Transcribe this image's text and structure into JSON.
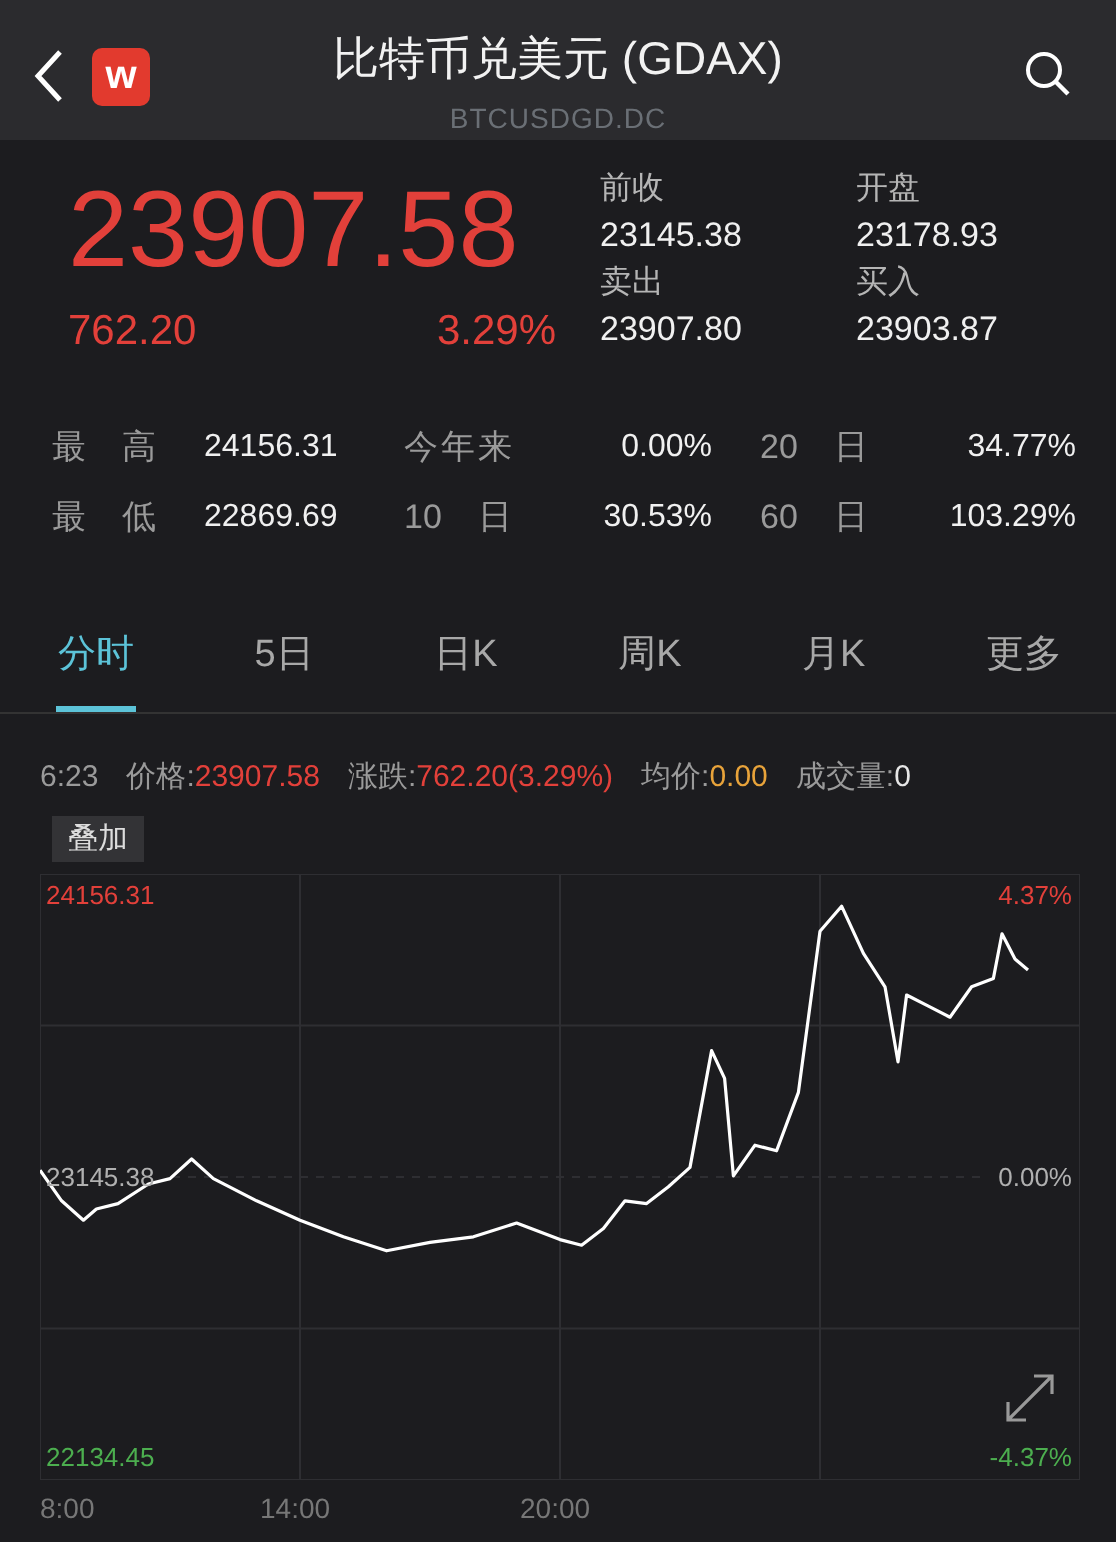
{
  "header": {
    "logo": "w",
    "title": "比特币兑美元 (GDAX)",
    "subtitle": "BTCUSDGD.DC"
  },
  "quote": {
    "price": "23907.58",
    "change": "762.20",
    "change_pct": "3.29%",
    "fields": [
      {
        "label": "前收",
        "value": "23145.38"
      },
      {
        "label": "开盘",
        "value": "23178.93"
      },
      {
        "label": "卖出",
        "value": "23907.80"
      },
      {
        "label": "买入",
        "value": "23903.87"
      }
    ]
  },
  "stats": [
    [
      {
        "label": "最 高",
        "value": "24156.31"
      },
      {
        "label": "今年来",
        "value": "0.00%"
      },
      {
        "label": "20 日",
        "value": "34.77%"
      }
    ],
    [
      {
        "label": "最 低",
        "value": "22869.69"
      },
      {
        "label": "10 日",
        "value": "30.53%"
      },
      {
        "label": "60 日",
        "value": "103.29%"
      }
    ]
  ],
  "tabs": [
    {
      "label": "分时",
      "selected": true
    },
    {
      "label": "5日",
      "selected": false
    },
    {
      "label": "日K",
      "selected": false
    },
    {
      "label": "周K",
      "selected": false
    },
    {
      "label": "月K",
      "selected": false
    },
    {
      "label": "更多",
      "selected": false
    }
  ],
  "info_bar": {
    "time": "6:23",
    "items": [
      {
        "label": "价格:",
        "value": "23907.58",
        "color": "#e2403a"
      },
      {
        "label": "涨跌:",
        "value": "762.20(3.29%)",
        "color": "#e2403a"
      },
      {
        "label": "均价:",
        "value": "0.00",
        "color": "#e8a33a"
      },
      {
        "label": "成交量:",
        "value": "0",
        "color": "#e6e6e6"
      }
    ]
  },
  "chart": {
    "overlay_button": "叠加",
    "right_labels": [
      {
        "text": "4.37%",
        "color": "#e2403a"
      },
      {
        "text": "0.00%",
        "color": "#b0b0b0"
      },
      {
        "text": "-4.37%",
        "color": "#4cae4f"
      }
    ],
    "chart_data": {
      "type": "line",
      "ylim": [
        22055.3,
        24235.5
      ],
      "yticks": [
        {
          "value": 24156.31,
          "label": "24156.31"
        },
        {
          "value": 23145.38,
          "label": "23145.38"
        },
        {
          "value": 22134.45,
          "label": "22134.45"
        }
      ],
      "xlim": [
        8,
        32
      ],
      "xticks": [
        {
          "value": 8,
          "label": "8:00"
        },
        {
          "value": 14,
          "label": "14:00"
        },
        {
          "value": 20,
          "label": "20:00"
        }
      ],
      "x": [
        8,
        8.5,
        9,
        9.3,
        9.8,
        10.5,
        11,
        11.5,
        12,
        13,
        14,
        15,
        16,
        17,
        18,
        19,
        20,
        20.5,
        21,
        21.5,
        22,
        22.5,
        23,
        23.5,
        23.8,
        24,
        24.5,
        25,
        25.5,
        26,
        26.5,
        27,
        27.5,
        27.8,
        28,
        28.5,
        29,
        29.5,
        30,
        30.2,
        30.5,
        30.8
      ],
      "series": [
        {
          "color": "#ffffff",
          "values": [
            23170,
            23060,
            22990,
            23030,
            23050,
            23120,
            23140,
            23210,
            23140,
            23060,
            22990,
            22930,
            22880,
            22910,
            22930,
            22980,
            22920,
            22900,
            22960,
            23060,
            23050,
            23110,
            23180,
            23600,
            23500,
            23150,
            23260,
            23240,
            23450,
            24030,
            24120,
            23950,
            23830,
            23560,
            23800,
            23760,
            23720,
            23830,
            23860,
            24020,
            23930,
            23890
          ]
        }
      ]
    }
  }
}
